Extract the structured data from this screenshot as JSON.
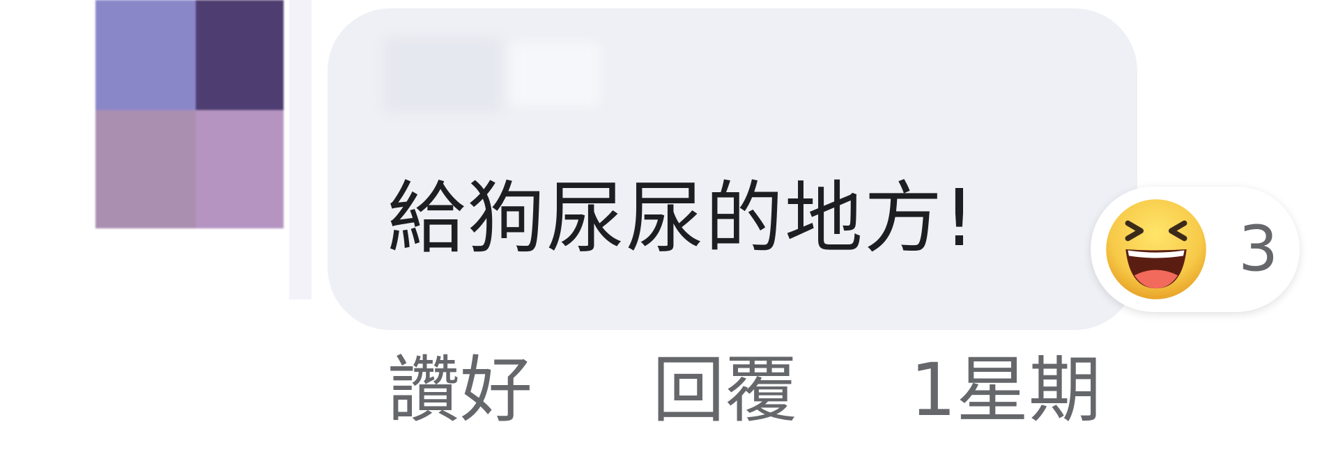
{
  "comment": {
    "text": "給狗尿尿的地方!",
    "reaction": {
      "icon": "haha-emoji-icon",
      "count": "3"
    }
  },
  "actions": {
    "like_label": "讚好",
    "reply_label": "回覆",
    "timestamp": "1星期"
  }
}
